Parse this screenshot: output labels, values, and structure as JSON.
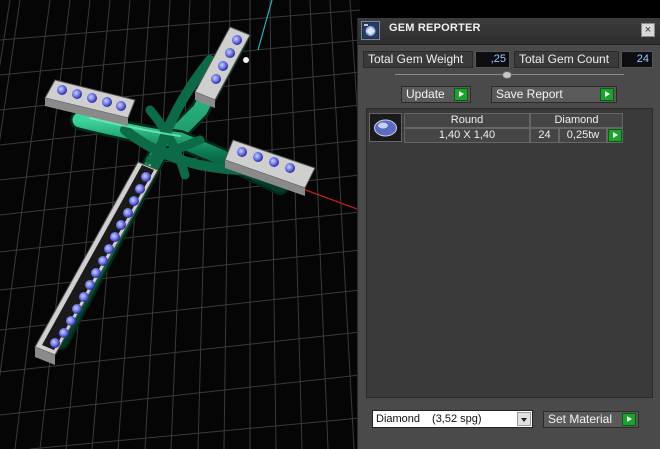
{
  "panel": {
    "title": "GEM REPORTER",
    "close_label": "×",
    "total_weight_label": "Total Gem Weight",
    "total_weight_value": ",25",
    "total_count_label": "Total Gem Count",
    "total_count_value": "24",
    "update_label": "Update",
    "save_report_label": "Save Report"
  },
  "report": {
    "rows": [
      {
        "shape": "Round",
        "size": "1,40 X 1,40",
        "material": "Diamond",
        "count": "24",
        "weight": "0,25tw"
      }
    ]
  },
  "material": {
    "name": "Diamond",
    "spg": "(3,52 spg)"
  },
  "set_material_label": "Set Material",
  "colors": {
    "accent_green": "#1fa030",
    "value_blue": "#9fc8ff",
    "tube_green": "#0e7a55"
  }
}
